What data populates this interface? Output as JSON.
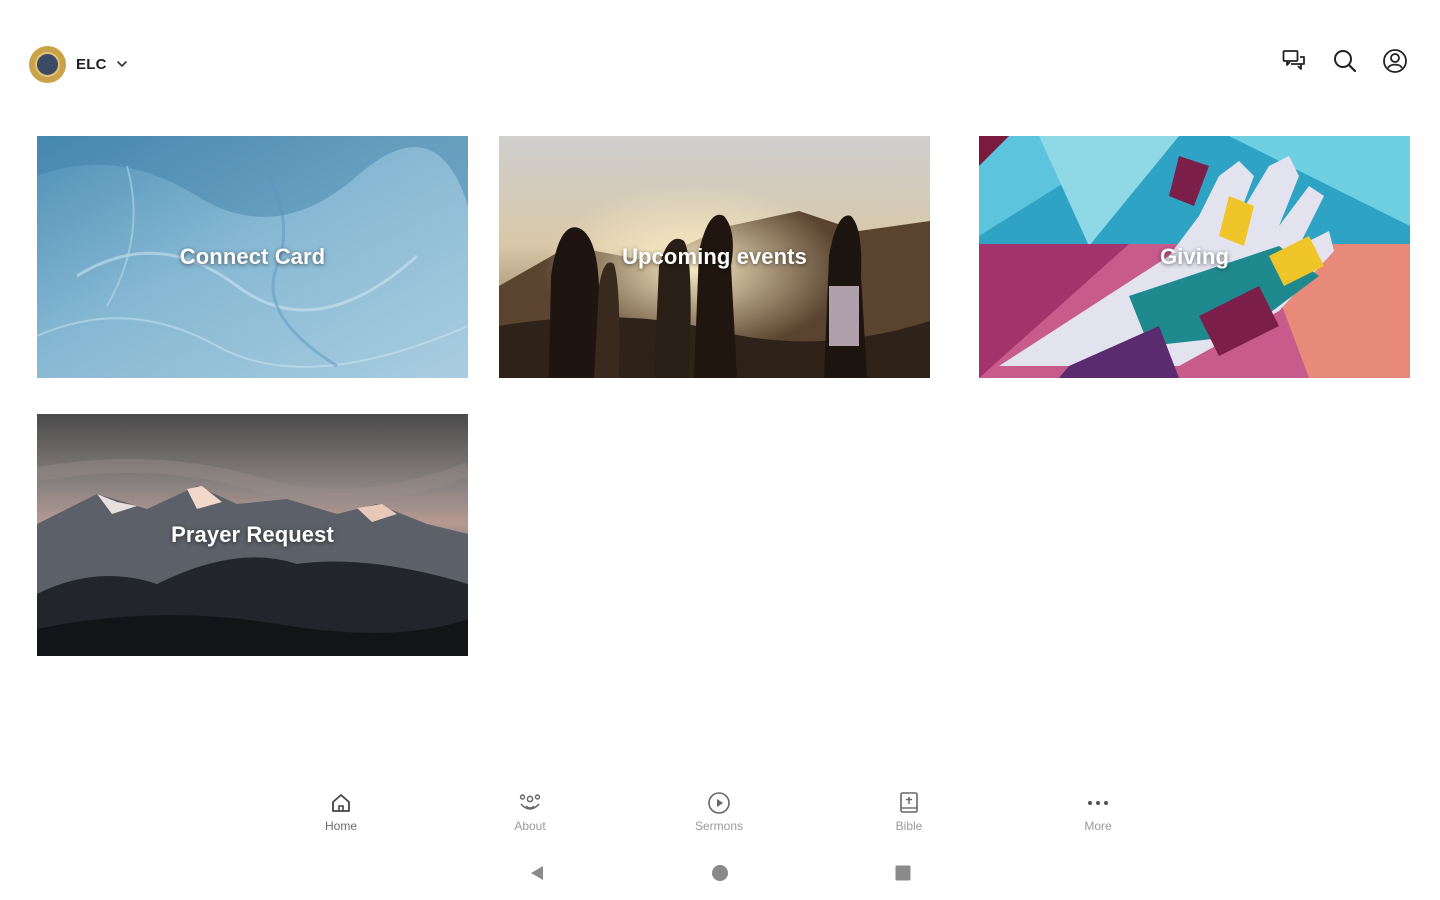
{
  "header": {
    "org_name": "ELC",
    "icons": {
      "avatar": "church-logo",
      "dropdown": "chevron-down-icon",
      "messages": "chat-icon",
      "search": "search-icon",
      "profile": "account-icon"
    }
  },
  "cards": [
    {
      "title": "Connect Card"
    },
    {
      "title": "Upcoming events"
    },
    {
      "title": "Giving"
    },
    {
      "title": "Prayer Request"
    }
  ],
  "bottom_nav": {
    "items": [
      {
        "label": "Home",
        "icon": "home-icon",
        "active": true
      },
      {
        "label": "About",
        "icon": "about-icon",
        "active": false
      },
      {
        "label": "Sermons",
        "icon": "play-circle-icon",
        "active": false
      },
      {
        "label": "Bible",
        "icon": "bible-icon",
        "active": false
      },
      {
        "label": "More",
        "icon": "more-icon",
        "active": false
      }
    ]
  },
  "system_nav": {
    "icons": [
      "back-icon",
      "home-circle-icon",
      "recents-icon"
    ]
  },
  "colors": {
    "avatar_ring": "#c9a24a",
    "nav_label": "#9a9a9a",
    "card_title": "#ffffff"
  }
}
